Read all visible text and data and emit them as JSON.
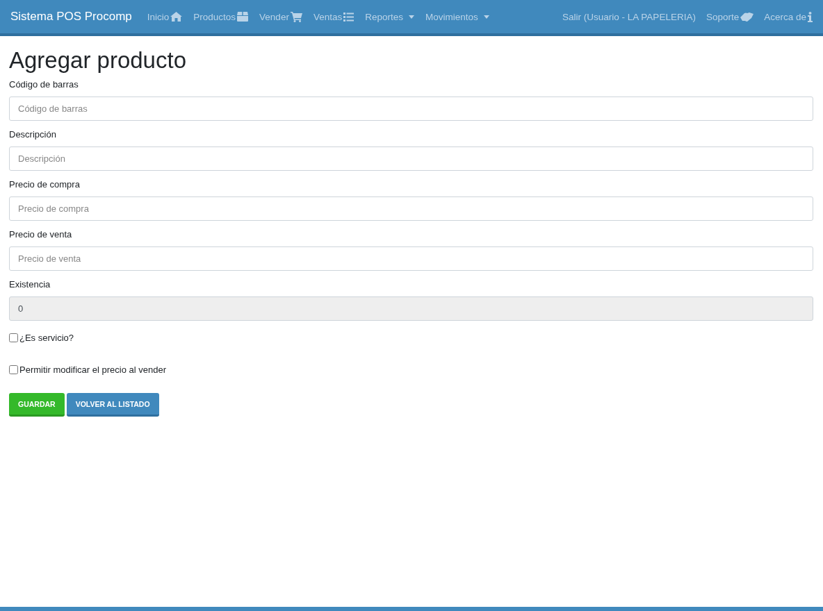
{
  "navbar": {
    "brand": "Sistema POS Procomp",
    "left_items": [
      {
        "label": "Inicio",
        "kind": "link"
      },
      {
        "label": "Productos",
        "kind": "link"
      },
      {
        "label": "Vender",
        "kind": "link"
      },
      {
        "label": "Ventas",
        "kind": "link"
      },
      {
        "label": "Reportes",
        "kind": "dropdown"
      },
      {
        "label": "Movimientos",
        "kind": "dropdown"
      }
    ],
    "right_items": [
      {
        "label": "Salir (Usuario - LA PAPELERIA)",
        "kind": "link"
      },
      {
        "label": "Soporte",
        "kind": "link"
      },
      {
        "label": "Acerca de",
        "kind": "link"
      }
    ]
  },
  "page_title": "Agregar producto",
  "fields": [
    {
      "label": "Código de barras",
      "placeholder": "Código de barras",
      "disabled": false
    },
    {
      "label": "Descripción",
      "placeholder": "Descripción",
      "disabled": false
    },
    {
      "label": "Precio de compra",
      "placeholder": "Precio de compra",
      "disabled": false
    },
    {
      "label": "Precio de venta",
      "placeholder": "Precio de venta",
      "disabled": false
    },
    {
      "label": "Existencia",
      "value": "0",
      "disabled": true
    }
  ],
  "checkboxes": [
    {
      "label": "¿Es servicio?",
      "checked": false
    },
    {
      "label": "Permitir modificar el precio al vender",
      "checked": false
    }
  ],
  "buttons": [
    {
      "label": "GUARDAR",
      "kind": "success"
    },
    {
      "label": "VOLVER AL LISTADO",
      "kind": "primary"
    }
  ]
}
